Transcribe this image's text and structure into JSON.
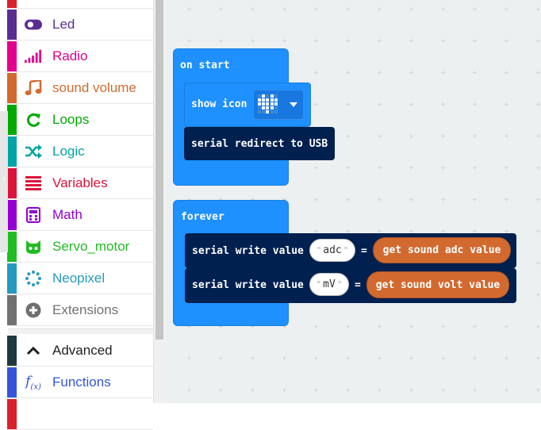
{
  "toolbox": {
    "categories": [
      {
        "label": "Led",
        "color": "#5c2d91",
        "icon": "toggle-icon"
      },
      {
        "label": "Radio",
        "color": "#e3008c",
        "icon": "signal-bars-icon"
      },
      {
        "label": "sound volume",
        "color": "#d26a30",
        "icon": "music-note-icon"
      },
      {
        "label": "Loops",
        "color": "#00aa00",
        "icon": "loop-arrow-icon"
      },
      {
        "label": "Logic",
        "color": "#00a4a6",
        "icon": "shuffle-icon"
      },
      {
        "label": "Variables",
        "color": "#dc143c",
        "icon": "list-lines-icon"
      },
      {
        "label": "Math",
        "color": "#9400d3",
        "icon": "calculator-icon"
      },
      {
        "label": "Servo_motor",
        "color": "#22bb22",
        "icon": "cat-face-icon"
      },
      {
        "label": "Neopixel",
        "color": "#2699bf",
        "icon": "dotted-circle-icon"
      },
      {
        "label": "Extensions",
        "color": "#717171",
        "icon": "plus-circle-icon"
      },
      {
        "label": "Advanced",
        "color": "#1f1f1f",
        "icon": "chevron-up-icon"
      },
      {
        "label": "Functions",
        "color": "#3455db",
        "icon": "function-fx-icon"
      }
    ],
    "top_partial_color": "#d9212c",
    "bottom_partial_color": "#d9212c"
  },
  "workspace": {
    "on_start": {
      "hat_label": "on start",
      "show_icon_label": "show icon",
      "serial_redirect_label": "serial redirect to USB"
    },
    "forever": {
      "hat_label": "forever",
      "rows": [
        {
          "label": "serial write value",
          "name": "adc",
          "equals": "=",
          "reporter": "get sound adc value"
        },
        {
          "label": "serial write value",
          "name": "mV",
          "equals": "=",
          "reporter": "get sound volt value"
        }
      ]
    }
  },
  "colors": {
    "event_blue": "#1e90ff",
    "serial_navy": "#002050",
    "sound_orange": "#d26a30"
  }
}
